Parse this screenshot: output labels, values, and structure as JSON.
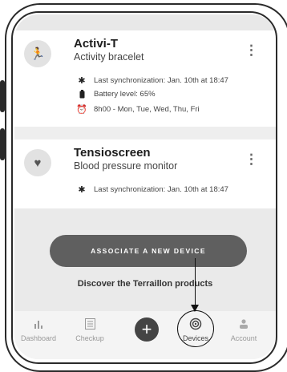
{
  "devices": [
    {
      "name": "Activi-T",
      "type": "Activity bracelet",
      "icon": "running-person-icon",
      "rows": [
        {
          "icon": "bluetooth-icon",
          "text": "Last synchronization: Jan. 10th at 18:47"
        },
        {
          "icon": "battery-icon",
          "text": "Battery level: 65%"
        },
        {
          "icon": "alarm-clock-icon",
          "text": "8h00 - Mon, Tue, Wed, Thu, Fri"
        }
      ]
    },
    {
      "name": "Tensioscreen",
      "type": "Blood pressure monitor",
      "icon": "heart-pulse-icon",
      "rows": [
        {
          "icon": "bluetooth-icon",
          "text": "Last synchronization: Jan. 10th at 18:47"
        }
      ]
    }
  ],
  "associate_button": "ASSOCIATE A NEW DEVICE",
  "discover_link": "Discover the Terraillon products",
  "tabs": [
    {
      "label": "Dashboard",
      "icon": "bar-chart-icon"
    },
    {
      "label": "Checkup",
      "icon": "checklist-icon"
    },
    {
      "label": "",
      "icon": "plus-icon"
    },
    {
      "label": "Devices",
      "icon": "wireless-signal-icon",
      "active": true
    },
    {
      "label": "Account",
      "icon": "person-icon"
    }
  ],
  "colors": {
    "accent_button": "#5f5f5f",
    "background": "#eeeeee",
    "card": "#ffffff"
  }
}
